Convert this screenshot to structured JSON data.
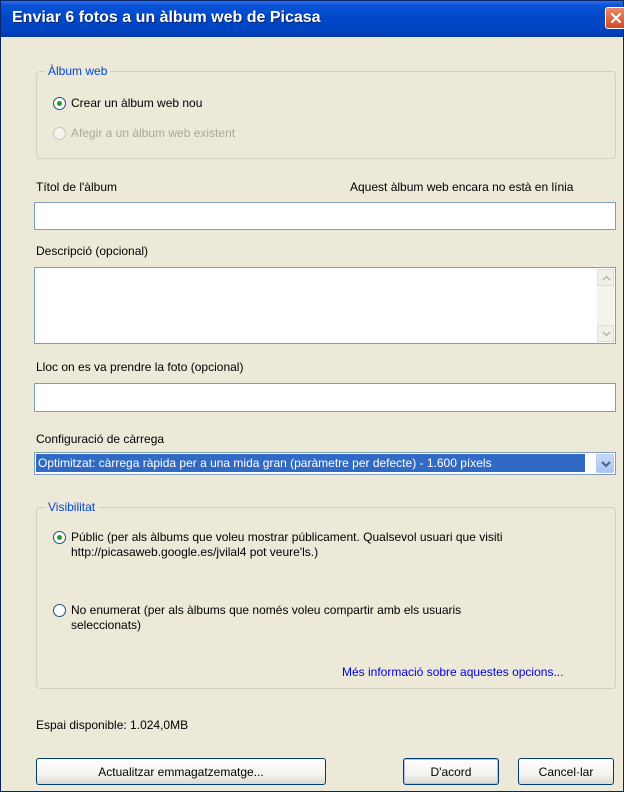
{
  "window": {
    "title": "Enviar 6 fotos a un àlbum web de Picasa"
  },
  "album_group": {
    "label": "Àlbum web",
    "create_new": "Crear un àlbum web nou",
    "add_existing": "Afegir a un àlbum web existent"
  },
  "album_title": {
    "label": "Títol de l'àlbum",
    "status": "Aquest àlbum web encara no està en línia",
    "value": ""
  },
  "description": {
    "label": "Descripció (opcional)",
    "value": ""
  },
  "location": {
    "label": "Lloc on es va prendre la foto (opcional)",
    "value": ""
  },
  "upload_settings": {
    "label": "Configuració de càrrega",
    "selected": "Optimitzat: càrrega ràpida per a una mida gran (paràmetre per defecte) - 1.600 píxels"
  },
  "visibility": {
    "label": "Visibilitat",
    "public_line1": "Públic (per als àlbums que voleu mostrar públicament. Qualsevol usuari que visiti",
    "public_line2": "http://picasaweb.google.es/jvilal4 pot veure'ls.)",
    "unlisted_line1": "No enumerat (per als àlbums que només voleu compartir amb els usuaris",
    "unlisted_line2": "seleccionats)",
    "more_info": "Més informació sobre aquestes opcions..."
  },
  "storage": {
    "available": "Espai disponible: 1.024,0MB"
  },
  "buttons": {
    "upgrade": "Actualitzar emmagatzematge...",
    "ok": "D'acord",
    "cancel": "Cancel·lar"
  },
  "colors": {
    "titlebar": "#0047c8",
    "group_label": "#0046d5",
    "selection": "#316ac5",
    "radio_dot": "#21a121"
  }
}
